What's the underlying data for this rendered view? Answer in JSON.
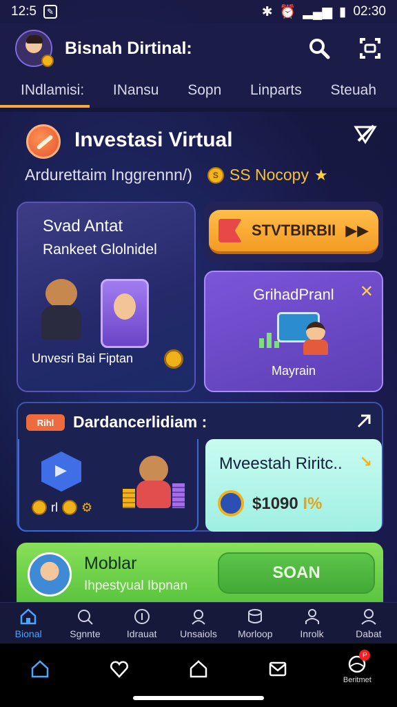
{
  "status_bar": {
    "time": "12:5",
    "clock_right": "02:30"
  },
  "header": {
    "title": "Bisnah Dirtinal:"
  },
  "tabs": [
    {
      "label": "INdlamisi:",
      "active": true
    },
    {
      "label": "INansu",
      "active": false
    },
    {
      "label": "Sopn",
      "active": false
    },
    {
      "label": "Linparts",
      "active": false
    },
    {
      "label": "Steuah",
      "active": false
    }
  ],
  "intro": {
    "title": "Investasi Virtual",
    "subtitle": "Ardurettaim Inggrennn/)",
    "coin_label": "S",
    "points": "SS Nocopy"
  },
  "card_left": {
    "title": "Svad Antat",
    "subtitle": "Rankeet Glolnidel",
    "caption": "Unvesri Bai Fiptan"
  },
  "start_button": {
    "label": "STVTBIRBII"
  },
  "card_purple": {
    "title": "GrihadPranl",
    "caption": "Mayrain"
  },
  "panel": {
    "badge": "Rihl",
    "title": "Dardancerlidiam :",
    "coins_label": "rl",
    "right_card": {
      "title": "Mveestah Riritc..",
      "amount": "$1090",
      "amount_suffix": "I%"
    }
  },
  "promo": {
    "title": "Moblar",
    "subtitle": "Ihpestyual Ibpnan",
    "button": "SOAN"
  },
  "bottom_nav": [
    {
      "label": "Bional",
      "icon": "home-icon"
    },
    {
      "label": "Sgnnte",
      "icon": "search-icon"
    },
    {
      "label": "Idrauat",
      "icon": "info-icon"
    },
    {
      "label": "Unsaiols",
      "icon": "users-icon"
    },
    {
      "label": "Morloop",
      "icon": "database-icon"
    },
    {
      "label": "Inrolk",
      "icon": "person-icon"
    },
    {
      "label": "Dabat",
      "icon": "profile-icon"
    }
  ],
  "system_nav": {
    "last_label": "Beritmet",
    "badge": "P"
  },
  "colors": {
    "accent_orange": "#f4a93a",
    "active_blue": "#47a6ff",
    "promo_green": "#58c33d"
  }
}
